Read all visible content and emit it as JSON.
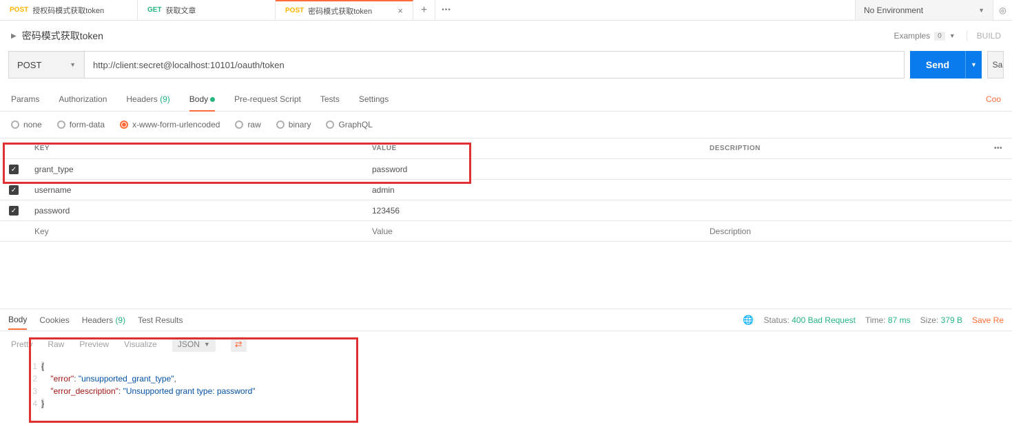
{
  "tabs": [
    {
      "method": "POST",
      "label": "授权码模式获取token"
    },
    {
      "method": "GET",
      "label": "获取文章"
    },
    {
      "method": "POST",
      "label": "密码模式获取token",
      "active": true
    }
  ],
  "environment": {
    "label": "No Environment"
  },
  "request": {
    "title": "密码模式获取token",
    "method": "POST",
    "url": "http://client:secret@localhost:10101/oauth/token",
    "sendLabel": "Send",
    "saveLabel": "Sa",
    "examplesLabel": "Examples",
    "examplesCount": "0",
    "buildLabel": "BUILD"
  },
  "reqTabs": {
    "params": "Params",
    "auth": "Authorization",
    "headers": "Headers",
    "headersCount": "(9)",
    "body": "Body",
    "prereq": "Pre-request Script",
    "tests": "Tests",
    "settings": "Settings",
    "cookies": "Coo"
  },
  "bodyTypes": {
    "none": "none",
    "formData": "form-data",
    "urlencoded": "x-www-form-urlencoded",
    "raw": "raw",
    "binary": "binary",
    "graphql": "GraphQL"
  },
  "paramsHeader": {
    "key": "KEY",
    "value": "VALUE",
    "desc": "DESCRIPTION"
  },
  "params": [
    {
      "key": "grant_type",
      "value": "password",
      "desc": ""
    },
    {
      "key": "username",
      "value": "admin",
      "desc": ""
    },
    {
      "key": "password",
      "value": "123456",
      "desc": ""
    }
  ],
  "emptyRow": {
    "key": "Key",
    "value": "Value",
    "desc": "Description"
  },
  "respTabs": {
    "body": "Body",
    "cookies": "Cookies",
    "headers": "Headers",
    "headersCount": "(9)",
    "testResults": "Test Results"
  },
  "respStatus": {
    "statusLabel": "Status:",
    "statusValue": "400 Bad Request",
    "timeLabel": "Time:",
    "timeValue": "87 ms",
    "sizeLabel": "Size:",
    "sizeValue": "379 B",
    "saveLabel": "Save Re"
  },
  "viewTabs": {
    "pretty": "Pretty",
    "raw": "Raw",
    "preview": "Preview",
    "visualize": "Visualize",
    "format": "JSON"
  },
  "responseBody": {
    "l1": "{",
    "l2k": "\"error\"",
    "l2v": "\"unsupported_grant_type\"",
    "l3k": "\"error_description\"",
    "l3v": "\"Unsupported grant type: password\"",
    "l4": "}"
  }
}
